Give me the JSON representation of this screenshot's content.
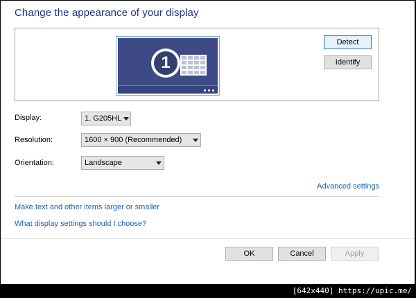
{
  "window": {
    "title": "Change the appearance of your display"
  },
  "preview": {
    "monitor_number": "1",
    "detect_label": "Detect",
    "identify_label": "Identify"
  },
  "settings": {
    "display": {
      "label": "Display:",
      "value": "1. G205HL"
    },
    "resolution": {
      "label": "Resolution:",
      "value": "1600 × 900 (Recommended)"
    },
    "orientation": {
      "label": "Orientation:",
      "value": "Landscape"
    }
  },
  "links": {
    "advanced": "Advanced settings",
    "larger_smaller": "Make text and other items larger or smaller",
    "what_settings": "What display settings should I choose?"
  },
  "footer": {
    "ok_label": "OK",
    "cancel_label": "Cancel",
    "apply_label": "Apply"
  },
  "watermark": {
    "text": "[642x440] https://upic.me/"
  },
  "colors": {
    "title": "#1e3287",
    "link": "#1a5fb4",
    "monitor_screen": "#3e4a86",
    "monitor_border": "#7fa6df"
  },
  "icons": {
    "dropdown": "chevron-down-icon",
    "monitor": "monitor-icon"
  }
}
